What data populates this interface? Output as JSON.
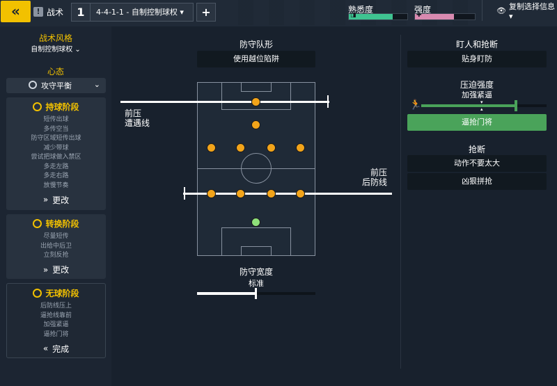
{
  "topbar": {
    "back_glyph": "«",
    "tactics_label": "战术",
    "tactic_slot": "1",
    "tactic_name": "4-4-1-1 - 自制控制球权 ▾",
    "add_glyph": "+",
    "familiarity_label": "熟悉度",
    "familiarity_level": 0.75,
    "intensity_label": "强度",
    "intensity_level": 0.65,
    "copy_label": "复制选择信息 ▾"
  },
  "sidebar": {
    "style_title": "战术风格",
    "style_value": "自制控制球权",
    "mentality_title": "心态",
    "mentality_value": "攻守平衡",
    "phases": [
      {
        "title": "持球阶段",
        "items": [
          "短传出球",
          "多传空当",
          "防守区域短传出球",
          "减少带球",
          "尝试把球做入禁区",
          "多走左路",
          "多走右路",
          "放慢节奏"
        ],
        "action": "更改",
        "action_glyph": "»"
      },
      {
        "title": "转换阶段",
        "items": [
          "尽量短传",
          "出给中后卫",
          "立刻反抢"
        ],
        "action": "更改",
        "action_glyph": "»"
      },
      {
        "title": "无球阶段",
        "items": [
          "后防线压上",
          "逼抢线靠前",
          "加强紧逼",
          "逼抢门将"
        ],
        "action": "完成",
        "action_glyph": "«"
      }
    ]
  },
  "center": {
    "shape_title": "防守队形",
    "shape_value": "使用越位陷阱",
    "engagement_label": [
      "前压",
      "遭遇线"
    ],
    "defline_label": [
      "前压",
      "后防线"
    ],
    "width_title": "防守宽度",
    "width_value": "标准",
    "width_level": 0.5
  },
  "right": {
    "marking_title": "盯人和抢断",
    "marking_value": "贴身盯防",
    "press_title": "压迫强度",
    "press_value": "加强紧逼",
    "press_level": 0.8,
    "gk_press_label": "逼抢门将",
    "tackle_title": "抢断",
    "tackle_options": [
      "动作不要太大",
      "凶狠拼抢"
    ]
  },
  "colors": {
    "accent": "#f2c100",
    "player": "#f2a41a",
    "gk": "#8fe07a",
    "green": "#4aa35a",
    "familiarity": "#3fc391",
    "intensity": "#d98ab0"
  }
}
